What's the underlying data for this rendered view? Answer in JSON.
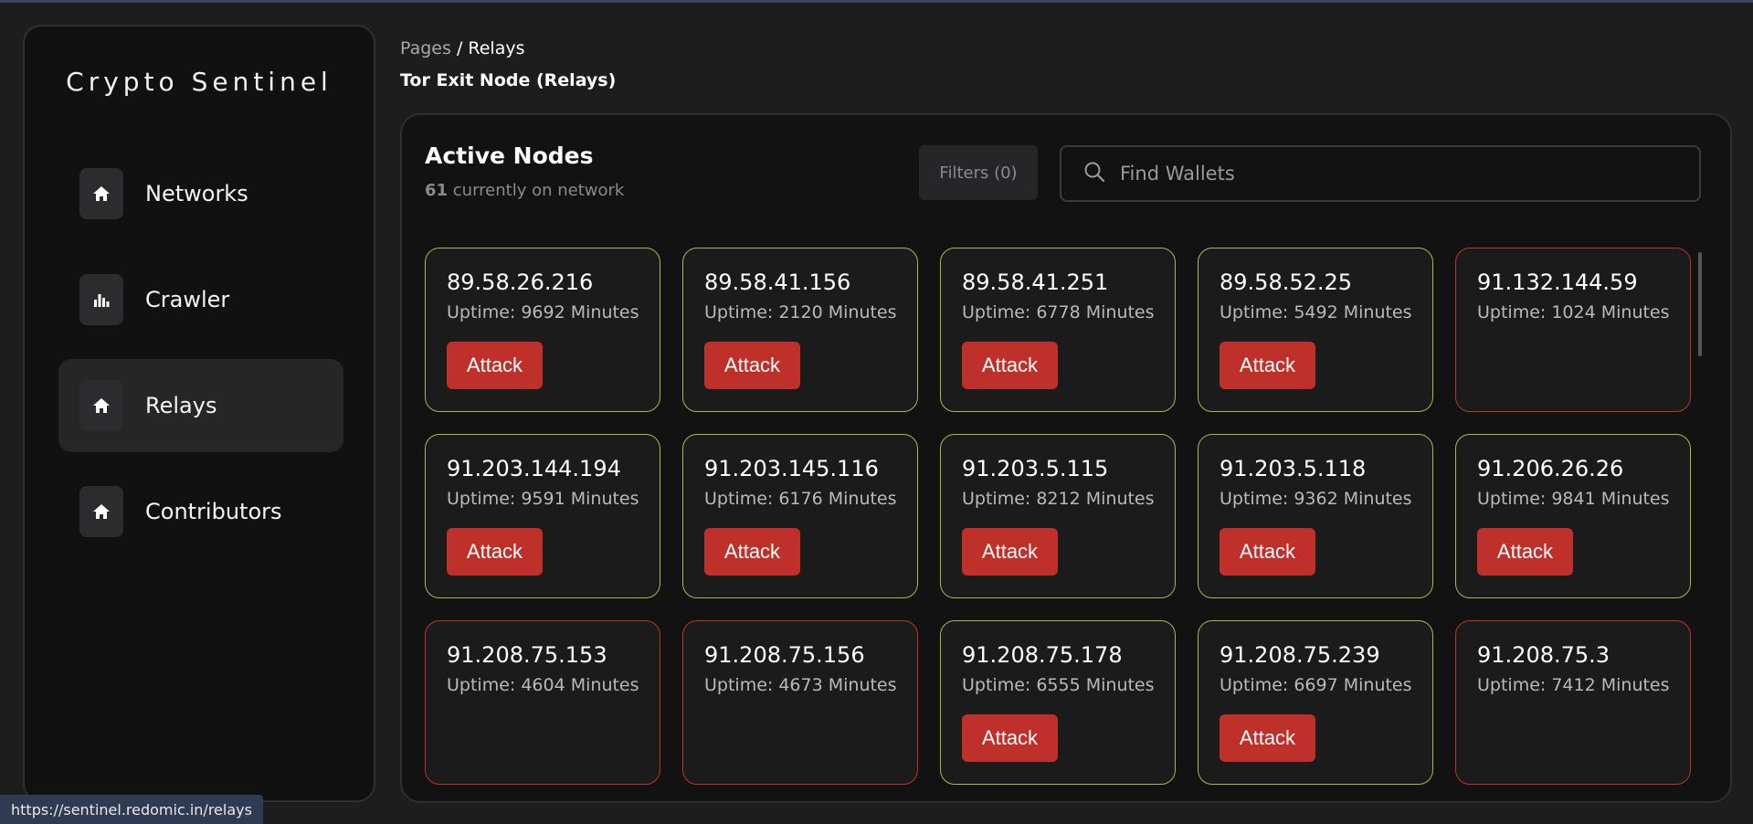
{
  "app": {
    "brand": "Crypto Sentinel"
  },
  "sidebar": {
    "items": [
      {
        "label": "Networks",
        "icon": "home-icon",
        "active": false
      },
      {
        "label": "Crawler",
        "icon": "bar-chart-icon",
        "active": false
      },
      {
        "label": "Relays",
        "icon": "home-icon",
        "active": true
      },
      {
        "label": "Contributors",
        "icon": "home-icon",
        "active": false
      }
    ]
  },
  "header": {
    "breadcrumb_root": "Pages",
    "breadcrumb_sep": " / ",
    "breadcrumb_current": "Relays",
    "title": "Tor Exit Node (Relays)"
  },
  "panel": {
    "title": "Active Nodes",
    "count": "61",
    "count_suffix": " currently on network",
    "filters_label": "Filters (0)",
    "search_placeholder": "Find Wallets"
  },
  "attack_label": "Attack",
  "colors": {
    "online_border": "#a8b74a",
    "offline_border": "#b8342c",
    "attack_button": "#c0302a"
  },
  "nodes": [
    {
      "ip": "89.58.26.216",
      "uptime": "Uptime: 9692 Minutes",
      "attackable": true
    },
    {
      "ip": "89.58.41.156",
      "uptime": "Uptime: 2120 Minutes",
      "attackable": true
    },
    {
      "ip": "89.58.41.251",
      "uptime": "Uptime: 6778 Minutes",
      "attackable": true
    },
    {
      "ip": "89.58.52.25",
      "uptime": "Uptime: 5492 Minutes",
      "attackable": true
    },
    {
      "ip": "91.132.144.59",
      "uptime": "Uptime: 1024 Minutes",
      "attackable": false
    },
    {
      "ip": "91.203.144.194",
      "uptime": "Uptime: 9591 Minutes",
      "attackable": true
    },
    {
      "ip": "91.203.145.116",
      "uptime": "Uptime: 6176 Minutes",
      "attackable": true
    },
    {
      "ip": "91.203.5.115",
      "uptime": "Uptime: 8212 Minutes",
      "attackable": true
    },
    {
      "ip": "91.203.5.118",
      "uptime": "Uptime: 9362 Minutes",
      "attackable": true
    },
    {
      "ip": "91.206.26.26",
      "uptime": "Uptime: 9841 Minutes",
      "attackable": true
    },
    {
      "ip": "91.208.75.153",
      "uptime": "Uptime: 4604 Minutes",
      "attackable": false
    },
    {
      "ip": "91.208.75.156",
      "uptime": "Uptime: 4673 Minutes",
      "attackable": false
    },
    {
      "ip": "91.208.75.178",
      "uptime": "Uptime: 6555 Minutes",
      "attackable": true
    },
    {
      "ip": "91.208.75.239",
      "uptime": "Uptime: 6697 Minutes",
      "attackable": true
    },
    {
      "ip": "91.208.75.3",
      "uptime": "Uptime: 7412 Minutes",
      "attackable": false
    }
  ],
  "status_bar": {
    "url": "https://sentinel.redomic.in/relays"
  }
}
